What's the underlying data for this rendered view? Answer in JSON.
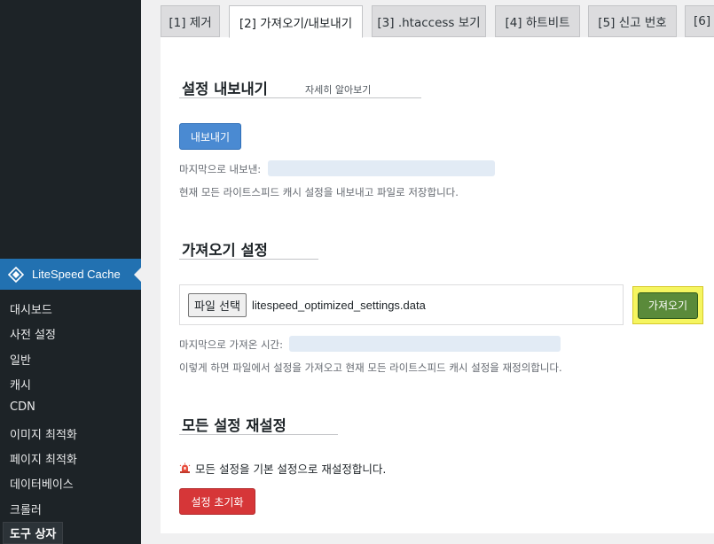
{
  "sidebar": {
    "plugin_label": "LiteSpeed Cache",
    "items": [
      {
        "label": "대시보드"
      },
      {
        "label": "사전 설정"
      },
      {
        "label": "일반"
      },
      {
        "label": "캐시"
      },
      {
        "label": "CDN"
      },
      {
        "label": "이미지 최적화"
      },
      {
        "label": "페이지 최적화"
      },
      {
        "label": "데이터베이스"
      },
      {
        "label": "크롤러"
      },
      {
        "label": "도구 상자"
      }
    ],
    "current": "도구 상자"
  },
  "tabs": [
    {
      "label": "[1] 제거"
    },
    {
      "label": "[2] 가져오기/내보내기"
    },
    {
      "label": "[3] .htaccess 보기"
    },
    {
      "label": "[4] 하트비트"
    },
    {
      "label": "[5] 신고 번호"
    },
    {
      "label": "[6]"
    }
  ],
  "active_tab": "[2] 가져오기/내보내기",
  "export": {
    "title": "설정 내보내기",
    "learn_more": "자세히 알아보기",
    "button": "내보내기",
    "last_label": "마지막으로 내보낸:",
    "description": "현재 모든 라이트스피드 캐시 설정을 내보내고 파일로 저장합니다."
  },
  "import": {
    "title": "가져오기 설정",
    "file_button": "파일 선택",
    "file_name": "litespeed_optimized_settings.data",
    "button": "가져오기",
    "last_label": "마지막으로 가져온 시간:",
    "description": "이렇게 하면 파일에서 설정을 가져오고 현재 모든 라이트스피드 캐시 설정을 재정의합니다."
  },
  "reset": {
    "title": "모든 설정 재설정",
    "warning": "모든 설정을 기본 설정으로 재설정합니다.",
    "button": "설정 초기화"
  },
  "colors": {
    "sidebar_bg": "#1d2327",
    "accent_blue": "#2271b1",
    "highlight_yellow": "#f5f560",
    "reset_red": "#d63638"
  }
}
